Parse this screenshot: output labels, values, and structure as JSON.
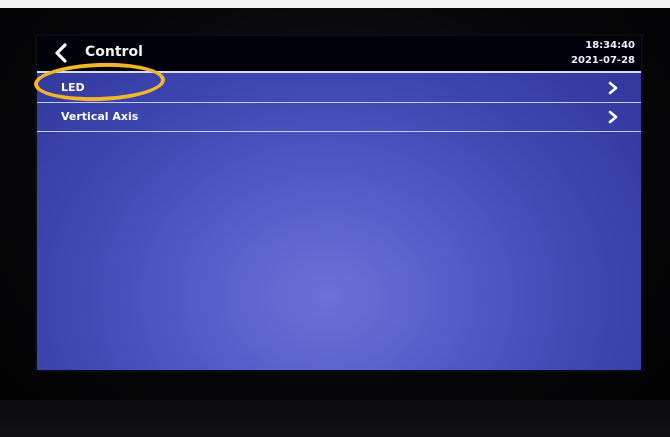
{
  "header": {
    "title": "Control",
    "time": "18:34:40",
    "date": "2021-07-28"
  },
  "menu": {
    "items": [
      {
        "label": "LED"
      },
      {
        "label": "Vertical Axis"
      }
    ]
  },
  "icons": {
    "back": "chevron-left-icon",
    "item_arrow": "chevron-right-icon"
  },
  "colors": {
    "screen_background": "#4a52c2",
    "header_background": "#02030a",
    "annotation_ring": "#f2b62a"
  }
}
